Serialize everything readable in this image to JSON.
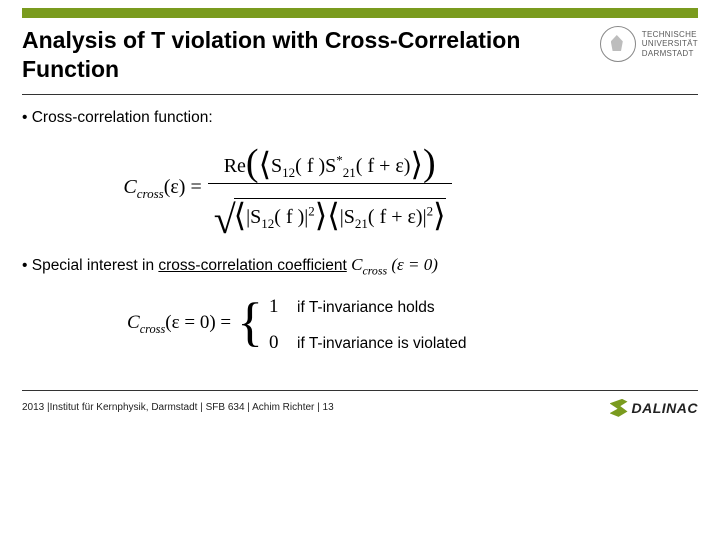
{
  "header": {
    "title": "Analysis of T violation with Cross-Correlation Function",
    "institution_line1": "TECHNISCHE",
    "institution_line2": "UNIVERSITÄT",
    "institution_line3": "DARMSTADT"
  },
  "body": {
    "bullet1": "• Cross-correlation function:",
    "formula": {
      "lhs_sym": "C",
      "lhs_sub": "cross",
      "lhs_arg": "(ε) =",
      "num_re": "Re",
      "num_s12": "S",
      "num_s12_sub": "12",
      "num_f": "( f )",
      "num_s21": "S",
      "num_s21_sub": "21",
      "num_s21_sup": "*",
      "num_fe": "( f + ε)",
      "den_s12": "S",
      "den_s12_sub": "12",
      "den_f1": "( f )",
      "den_s21": "S",
      "den_s21_sub": "21",
      "den_f2": "( f + ε)",
      "abs_sq": "2"
    },
    "bullet2_a": "• Special interest in ",
    "bullet2_u": "cross-correlation coefficient",
    "coef_sym": "C",
    "coef_sub": "cross",
    "coef_arg": " (ε = 0)",
    "case_lhs_sym": "C",
    "case_lhs_sub": "cross",
    "case_lhs_arg": "(ε = 0) =",
    "case1_num": "1",
    "case1_txt": "if T-invariance holds",
    "case0_num": "0",
    "case0_txt": "if T-invariance is violated"
  },
  "footer": {
    "left": "2013 |Institut für Kernphysik, Darmstadt  |  SFB 634 | Achim Richter | 13",
    "facility": "DALINAC"
  }
}
